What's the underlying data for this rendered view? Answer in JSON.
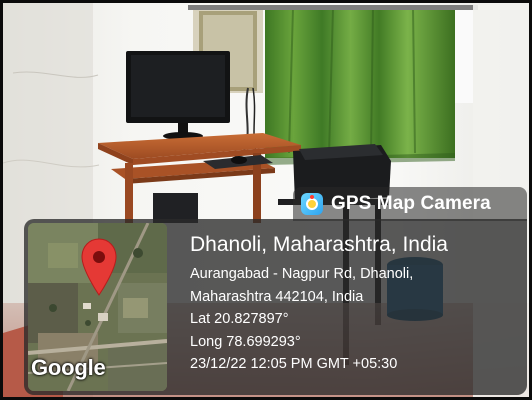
{
  "photo": {
    "description_icon": "room-photo",
    "colors": {
      "wall": "#f3f3f0",
      "curtain": "#4e8a2e",
      "desk": "#b65a2a",
      "monitor": "#101112",
      "printer": "#1b1c1e",
      "floor": "#b45f4c"
    }
  },
  "watermark": {
    "app_icon": "gps-map-camera-icon",
    "app_name": "GPS Map Camera"
  },
  "location": {
    "title": "Dhanoli, Maharashtra, India",
    "address_line1": "Aurangabad - Nagpur Rd, Dhanoli,",
    "address_line2": "Maharashtra 442104, India",
    "lat": "Lat 20.827897°",
    "long": "Long 78.699293°",
    "datetime": "23/12/22 12:05 PM GMT +05:30"
  },
  "map": {
    "brand": "Google",
    "pin_icon": "location-pin-icon",
    "pin_color": "#e53935"
  }
}
